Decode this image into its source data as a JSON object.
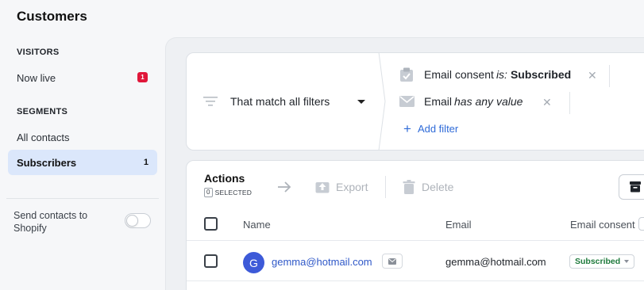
{
  "page": {
    "title": "Customers"
  },
  "sidebar": {
    "visitors_label": "VISITORS",
    "now_live": {
      "label": "Now live",
      "badge": "1"
    },
    "segments_label": "SEGMENTS",
    "segments": [
      {
        "label": "All contacts",
        "count": ""
      },
      {
        "label": "Subscribers",
        "count": "1"
      }
    ],
    "shopify": {
      "label": "Send contacts to Shopify",
      "enabled": false
    }
  },
  "filters": {
    "match_label": "That match all filters",
    "conditions": [
      {
        "icon": "clipboard-check-icon",
        "field": "Email consent",
        "operator": "is:",
        "value": "Subscribed"
      },
      {
        "icon": "envelope-icon",
        "field": "Email",
        "operator": "has any value",
        "value": ""
      }
    ],
    "add_filter_label": "Add filter"
  },
  "actions": {
    "title": "Actions",
    "selected_count": "0",
    "selected_label": "SELECTED",
    "export_label": "Export",
    "delete_label": "Delete"
  },
  "table": {
    "columns": [
      "Name",
      "Email",
      "Email consent"
    ],
    "rows": [
      {
        "avatar_initial": "G",
        "name": "gemma@hotmail.com",
        "email": "gemma@hotmail.com",
        "consent": "Subscribed"
      }
    ]
  },
  "colors": {
    "accent": "#2f6bd8",
    "active_bg": "#dbe7fb",
    "badge": "#e0173a",
    "avatar": "#3d5ad8",
    "subscribed": "#1e7a3c"
  }
}
